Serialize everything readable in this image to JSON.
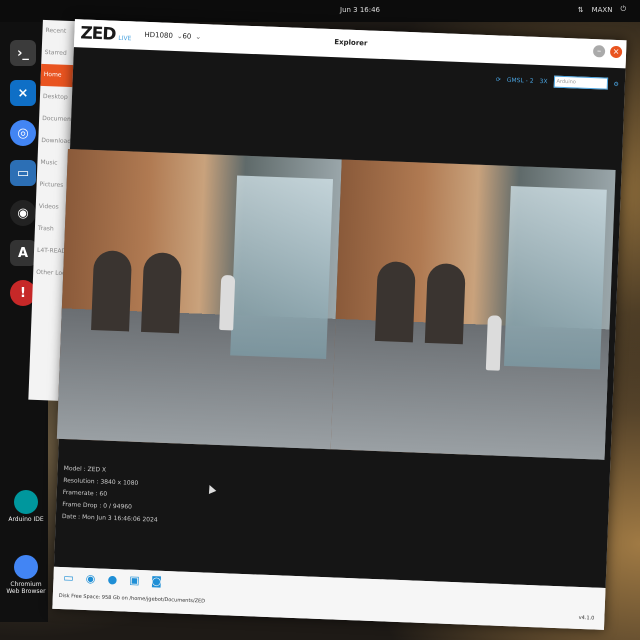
{
  "desktop": {
    "clock": "Jun 3  16:46",
    "user": "MAXN",
    "icons": [
      {
        "label": "Arduino IDE"
      },
      {
        "label": "Chromium Web Browser"
      }
    ]
  },
  "filemanager": {
    "items": [
      "Recent",
      "Starred",
      "Home",
      "Desktop",
      "Documents",
      "Downloads",
      "Music",
      "Pictures",
      "Videos",
      "Trash",
      "L4T-README",
      "Other Locations"
    ],
    "active_index": 2
  },
  "app": {
    "logo": "ZED",
    "logo_sub": "LIVE",
    "resolution": "HD1080",
    "fps": "60",
    "title": "Explorer",
    "connection": "GMSL - 2",
    "zoom_label": "3X",
    "search_placeholder": "Arduino"
  },
  "info": {
    "model": "Model : ZED X",
    "resolution": "Resolution : 3840 x 1080",
    "framerate": "Framerate : 60",
    "frame_drop": "Frame Drop : 0 / 94960",
    "date": "Date : Mon Jun 3 16:46:06 2024"
  },
  "footer": {
    "disk": "Disk Free Space: 958 Gb  on  /home/jgebot/Documents/ZED",
    "version": "v4.1.0"
  },
  "colors": {
    "accent": "#e95420",
    "zed_blue": "#1f8fd6"
  }
}
